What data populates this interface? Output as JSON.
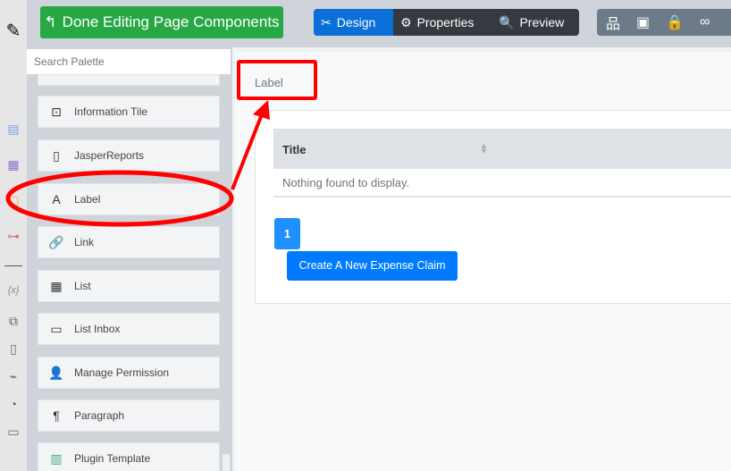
{
  "toolbar": {
    "done_label": "Done Editing Page Components",
    "tabs": [
      "Design",
      "Properties",
      "Preview"
    ]
  },
  "palette": {
    "search_placeholder": "Search Palette",
    "items": [
      "Information Tile",
      "JasperReports",
      "Label",
      "Link",
      "List",
      "List Inbox",
      "Manage Permission",
      "Paragraph",
      "Plugin Template"
    ]
  },
  "canvas": {
    "label_text": "Label",
    "table": {
      "column": "Title",
      "empty": "Nothing found to display."
    },
    "page": "1",
    "create_button": "Create A New Expense Claim"
  },
  "colors": {
    "accent": "#007bff",
    "done": "#28a745",
    "annotation": "#ff0000"
  }
}
